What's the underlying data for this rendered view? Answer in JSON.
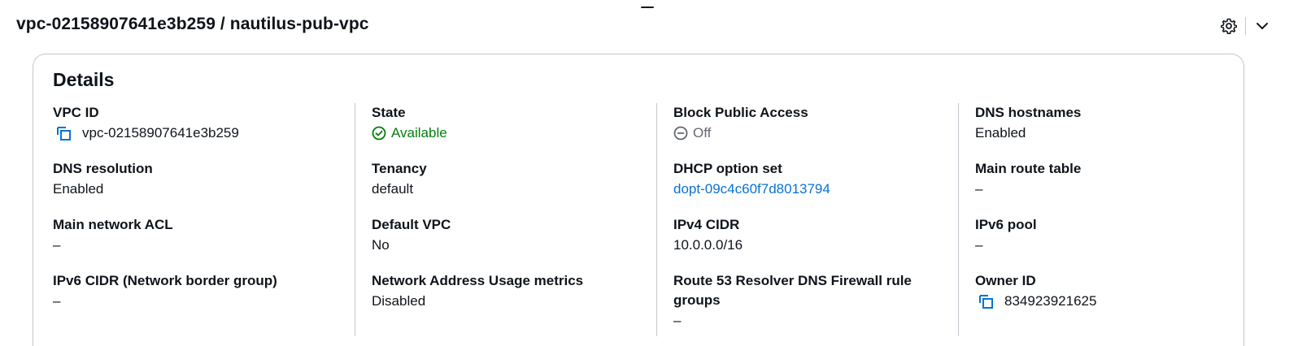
{
  "header": {
    "title": "vpc-02158907641e3b259 / nautilus-pub-vpc"
  },
  "top_actions": {
    "settings_icon": "gear-icon",
    "collapse_icon": "chevron-down-icon"
  },
  "details": {
    "title": "Details",
    "columns": [
      [
        {
          "label": "VPC ID",
          "value": "vpc-02158907641e3b259"
        },
        {
          "label": "DNS resolution",
          "value": "Enabled"
        },
        {
          "label": "Main network ACL",
          "value": "–"
        },
        {
          "label": "IPv6 CIDR (Network border group)",
          "value": "–"
        }
      ],
      [
        {
          "label": "State",
          "value": "Available"
        },
        {
          "label": "Tenancy",
          "value": "default"
        },
        {
          "label": "Default VPC",
          "value": "No"
        },
        {
          "label": "Network Address Usage metrics",
          "value": "Disabled"
        }
      ],
      [
        {
          "label": "Block Public Access",
          "value": "Off"
        },
        {
          "label": "DHCP option set",
          "value": "dopt-09c4c60f7d8013794"
        },
        {
          "label": "IPv4 CIDR",
          "value": "10.0.0.0/16"
        },
        {
          "label": "Route 53 Resolver DNS Firewall rule groups",
          "value": "–"
        }
      ],
      [
        {
          "label": "DNS hostnames",
          "value": "Enabled"
        },
        {
          "label": "Main route table",
          "value": "–"
        },
        {
          "label": "IPv6 pool",
          "value": "–"
        },
        {
          "label": "Owner ID",
          "value": "834923921625"
        }
      ]
    ]
  },
  "colors": {
    "link": "#0972d3",
    "success": "#037f0c",
    "muted": "#656871",
    "divider": "#c6c6cd"
  }
}
